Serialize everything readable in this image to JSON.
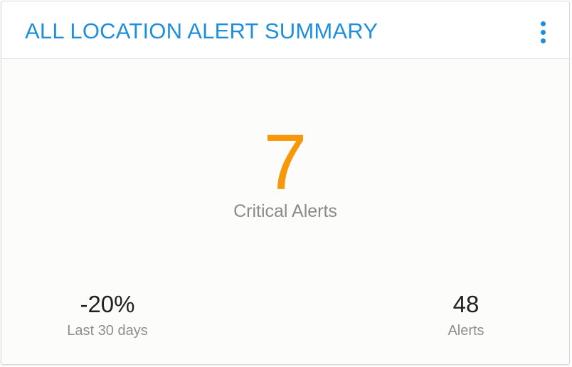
{
  "card": {
    "title": "ALL LOCATION ALERT SUMMARY",
    "menu_icon": "more-vertical-icon",
    "accent_color": "#1f8fdb",
    "highlight_color": "#f7980a"
  },
  "main_metric": {
    "value": "7",
    "label": "Critical Alerts"
  },
  "stats": {
    "change": {
      "value": "-20%",
      "label": "Last 30 days"
    },
    "alerts": {
      "value": "48",
      "label": "Alerts"
    }
  }
}
